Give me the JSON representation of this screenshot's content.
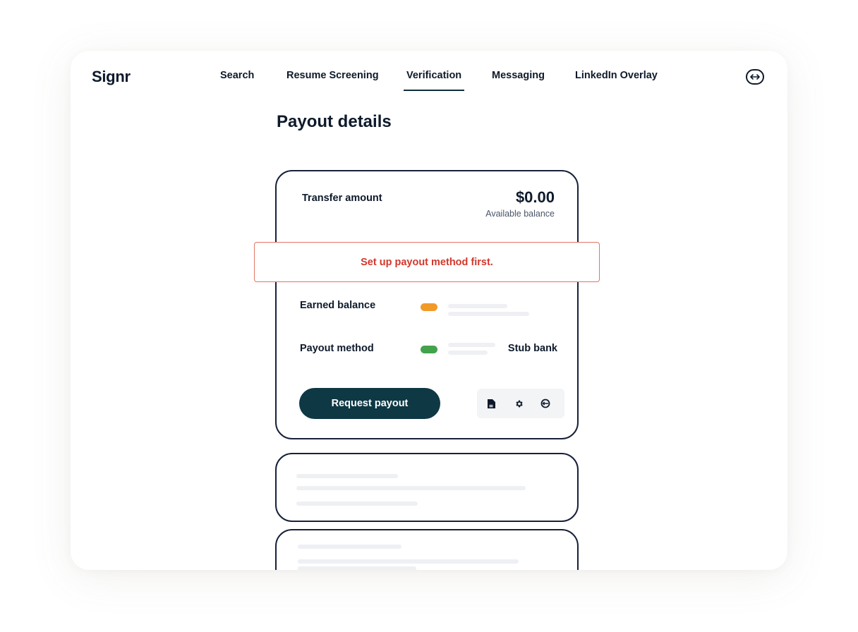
{
  "app": {
    "name": "Signr"
  },
  "nav": {
    "items": [
      {
        "label": "Search"
      },
      {
        "label": "Resume Screening"
      },
      {
        "label": "Verification",
        "active": true
      },
      {
        "label": "Messaging"
      },
      {
        "label": "LinkedIn Overlay"
      }
    ]
  },
  "page": {
    "title": "Payout details"
  },
  "payout": {
    "transfer_label": "Transfer amount",
    "amount": "$0.00",
    "available_label": "Available balance",
    "alert": "Set up payout method first.",
    "earned_label": "Earned balance",
    "method_label": "Payout method",
    "method_value": "Stub bank",
    "request_label": "Request payout"
  },
  "colors": {
    "brand_dark": "#0e3844",
    "text": "#0e1a2b",
    "alert": "#d3372b",
    "pill_orange": "#f19a2a",
    "pill_green": "#43a24c"
  },
  "icons": {
    "header": "swap-icon",
    "tools": [
      "document-icon",
      "gear-icon",
      "refresh-icon"
    ]
  }
}
